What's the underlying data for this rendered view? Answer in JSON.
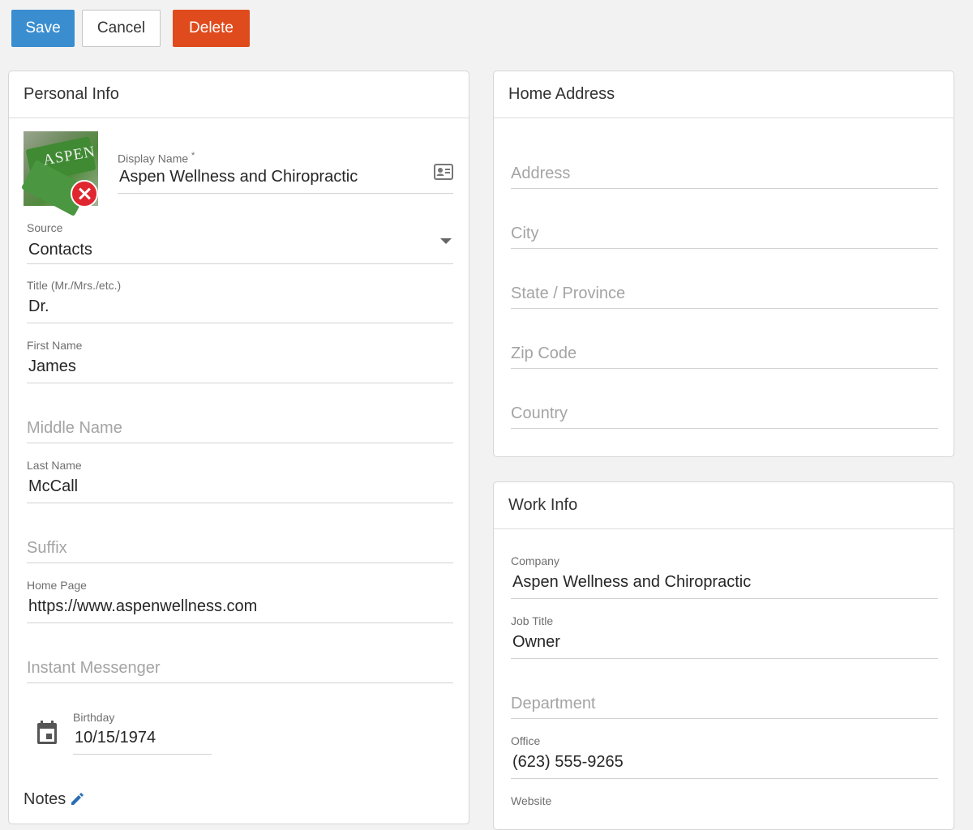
{
  "toolbar": {
    "save_label": "Save",
    "cancel_label": "Cancel",
    "delete_label": "Delete"
  },
  "colors": {
    "save": "#3a8ed0",
    "delete": "#e04b1e",
    "remove_badge": "#e0262f"
  },
  "personal_info": {
    "title": "Personal Info",
    "avatar": {
      "logo_text": "ASPEN",
      "remove_icon": "close-circle-icon"
    },
    "display_name": {
      "label": "Display Name",
      "required_mark": "*",
      "value": "Aspen Wellness and Chiropractic",
      "icon": "contact-card-icon"
    },
    "source": {
      "label": "Source",
      "value": "Contacts"
    },
    "title_field": {
      "label": "Title (Mr./Mrs./etc.)",
      "value": "Dr."
    },
    "first_name": {
      "label": "First Name",
      "value": "James"
    },
    "middle_name": {
      "placeholder": "Middle Name"
    },
    "last_name": {
      "label": "Last Name",
      "value": "McCall"
    },
    "suffix": {
      "placeholder": "Suffix"
    },
    "home_page": {
      "label": "Home Page",
      "value": "https://www.aspenwellness.com"
    },
    "instant_messenger": {
      "placeholder": "Instant Messenger"
    },
    "birthday": {
      "label": "Birthday",
      "value": "10/15/1974",
      "icon": "calendar-icon"
    },
    "notes_label": "Notes"
  },
  "home_address": {
    "title": "Home Address",
    "address": {
      "placeholder": "Address"
    },
    "city": {
      "placeholder": "City"
    },
    "state": {
      "placeholder": "State / Province"
    },
    "zip": {
      "placeholder": "Zip Code"
    },
    "country": {
      "placeholder": "Country"
    }
  },
  "work_info": {
    "title": "Work Info",
    "company": {
      "label": "Company",
      "value": "Aspen Wellness and Chiropractic"
    },
    "job_title": {
      "label": "Job Title",
      "value": "Owner"
    },
    "department": {
      "placeholder": "Department"
    },
    "office": {
      "label": "Office",
      "value": "(623) 555-9265"
    },
    "website": {
      "label": "Website"
    }
  }
}
